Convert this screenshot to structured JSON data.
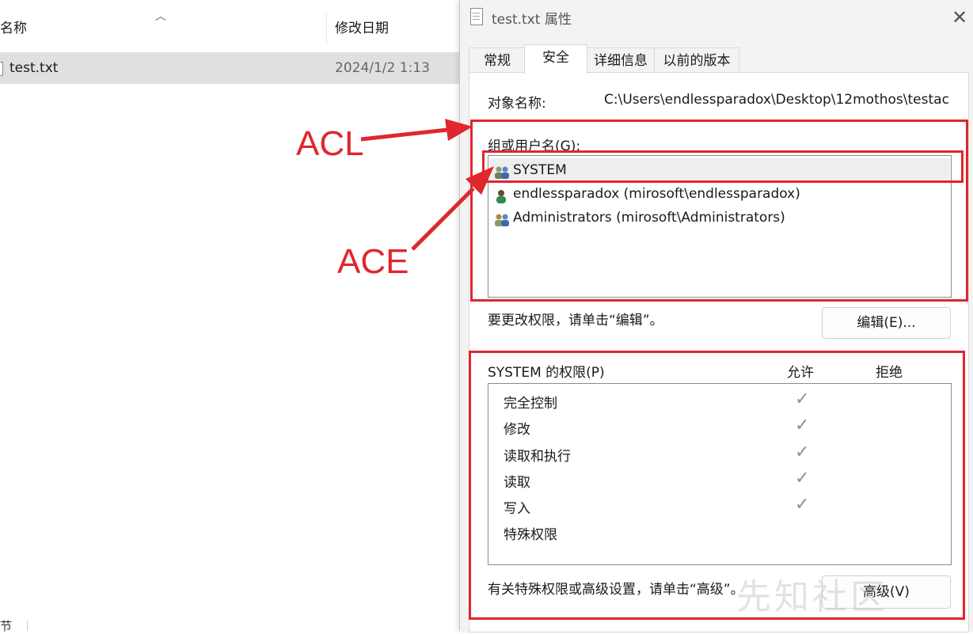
{
  "explorer": {
    "col_name": "名称",
    "col_modified": "修改日期",
    "file_name": "test.txt",
    "file_date": "2024/1/2 1:13",
    "bottom_char": "节"
  },
  "dialog": {
    "title": "test.txt 属性",
    "tabs": [
      "常规",
      "安全",
      "详细信息",
      "以前的版本"
    ],
    "object_label": "对象名称:",
    "object_path": "C:\\Users\\endlessparadox\\Desktop\\12mothos\\testac",
    "groups_label": "组或用户名(G):",
    "groups": [
      "SYSTEM",
      "endlessparadox (mirosoft\\endlessparadox)",
      "Administrators (mirosoft\\Administrators)"
    ],
    "edit_hint": "要更改权限，请单击“编辑”。",
    "edit_button": "编辑(E)...",
    "perm_header": "SYSTEM 的权限(P)",
    "allow_header": "允许",
    "deny_header": "拒绝",
    "permissions": [
      {
        "name": "完全控制",
        "allow": true
      },
      {
        "name": "修改",
        "allow": true
      },
      {
        "name": "读取和执行",
        "allow": true
      },
      {
        "name": "读取",
        "allow": true
      },
      {
        "name": "写入",
        "allow": true
      },
      {
        "name": "特殊权限",
        "allow": false
      }
    ],
    "advanced_hint": "有关特殊权限或高级设置，请单击“高级”。",
    "advanced_button": "高级(V)"
  },
  "annotations": {
    "acl": "ACL",
    "ace": "ACE",
    "color": "#e0262e"
  },
  "watermark": "先知社区"
}
